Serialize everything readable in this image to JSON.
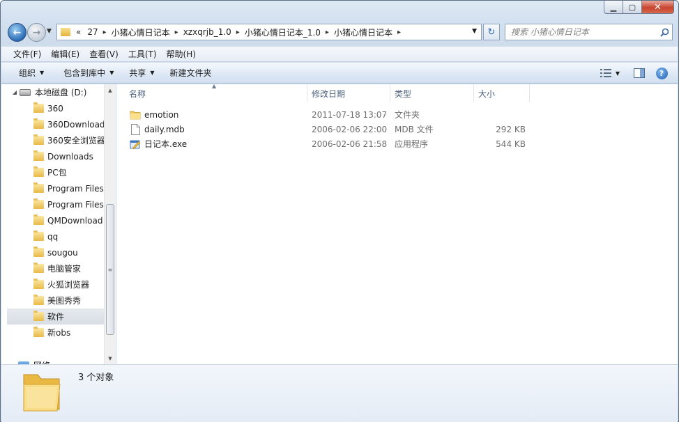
{
  "title_bar": {
    "minimize_symbol": "▁",
    "maximize_symbol": "▢",
    "close_symbol": "✕"
  },
  "address_bar": {
    "overflow": "«",
    "crumbs": [
      "27",
      "小猪心情日记本",
      "xzxqrjb_1.0",
      "小猪心情日记本_1.0",
      "小猪心情日记本"
    ]
  },
  "search": {
    "placeholder": "搜索 小猪心情日记本"
  },
  "menu": {
    "items": [
      "文件(F)",
      "编辑(E)",
      "查看(V)",
      "工具(T)",
      "帮助(H)"
    ]
  },
  "commands": {
    "organize": "组织",
    "include_in_library": "包含到库中",
    "share": "共享",
    "new_folder": "新建文件夹"
  },
  "nav_pane": {
    "drive": "本地磁盘 (D:)",
    "folders": [
      "360",
      "360Download",
      "360安全浏览器",
      "Downloads",
      "PC包",
      "Program Files",
      "Program Files",
      "QMDownload",
      "qq",
      "sougou",
      "电脑管家",
      "火狐浏览器",
      "美图秀秀",
      "软件",
      "新obs"
    ],
    "selected": "软件",
    "network": "网络"
  },
  "columns": {
    "name": "名称",
    "date": "修改日期",
    "type": "类型",
    "size": "大小"
  },
  "files": [
    {
      "name": "emotion",
      "date": "2011-07-18 13:07",
      "type": "文件夹",
      "size": "",
      "icon": "folder-icon"
    },
    {
      "name": "daily.mdb",
      "date": "2006-02-06 22:00",
      "type": "MDB 文件",
      "size": "292 KB",
      "icon": "document-icon"
    },
    {
      "name": "日记本.exe",
      "date": "2006-02-06 21:58",
      "type": "应用程序",
      "size": "544 KB",
      "icon": "application-icon"
    }
  ],
  "details": {
    "count": "3 个对象"
  },
  "colors": {
    "selection": "#d9dee5",
    "header_text": "#4c607a",
    "secondary_text": "#6d6d6d"
  }
}
